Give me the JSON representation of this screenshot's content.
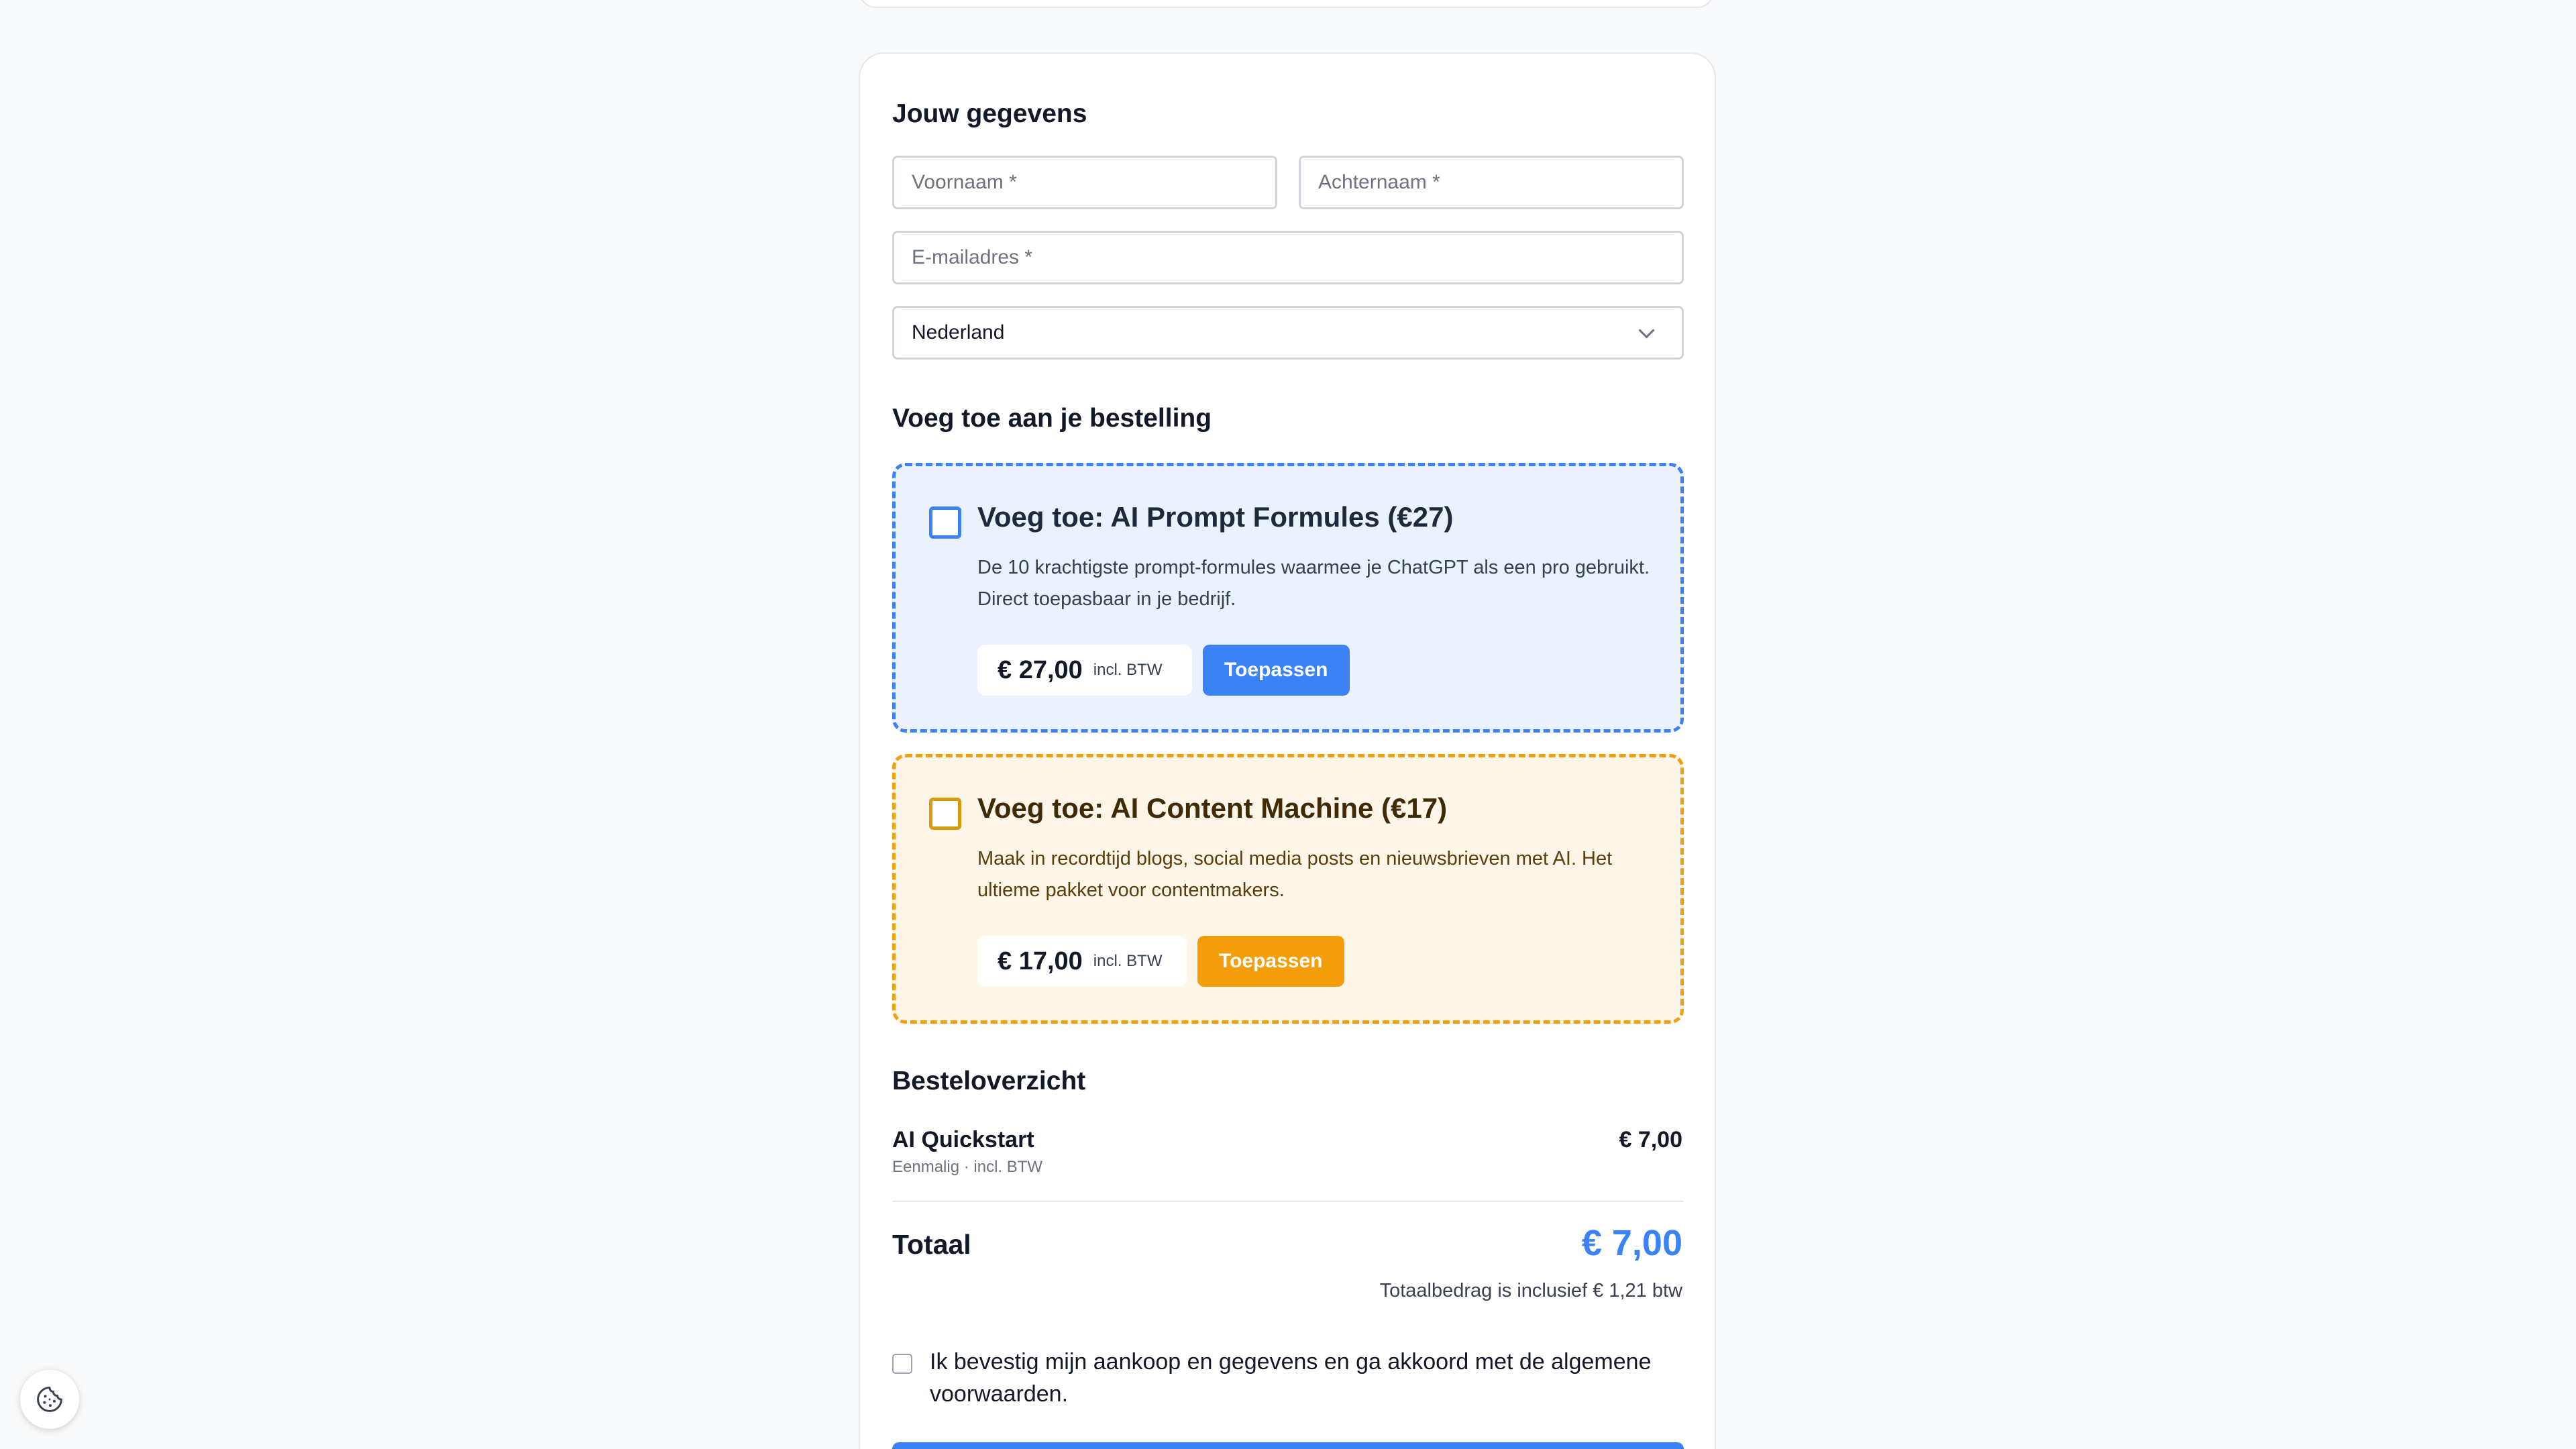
{
  "details": {
    "heading": "Jouw gegevens",
    "first_name_placeholder": "Voornaam *",
    "last_name_placeholder": "Achternaam *",
    "email_placeholder": "E-mailadres *",
    "country_value": "Nederland"
  },
  "order_bumps": {
    "heading": "Voeg toe aan je bestelling",
    "items": [
      {
        "title": "Voeg toe: AI Prompt Formules (€27)",
        "description": "De 10 krachtigste prompt-formules waarmee je ChatGPT als een pro gebruikt. Direct toepasbaar in je bedrijf.",
        "price": "€ 27,00",
        "price_note": "incl. BTW",
        "button_label": "Toepassen",
        "accent_color": "#3b82f6"
      },
      {
        "title": "Voeg toe: AI Content Machine (€17)",
        "description": "Maak in recordtijd blogs, social media posts en nieuwsbrieven met AI. Het ultieme pakket voor contentmakers.",
        "price": "€ 17,00",
        "price_note": "incl. BTW",
        "button_label": "Toepassen",
        "accent_color": "#f59e0b"
      }
    ]
  },
  "summary": {
    "heading": "Besteloverzicht",
    "product_name": "AI Quickstart",
    "product_meta": "Eenmalig · incl. BTW",
    "product_price": "€ 7,00",
    "total_label": "Totaal",
    "total_value": "€ 7,00",
    "total_color": "#3b82f6",
    "vat_note": "Totaalbedrag is inclusief € 1,21 btw"
  },
  "consent": {
    "text": "Ik bevestig mijn aankoop en gegevens en ga akkoord met de algemene voorwaarden."
  },
  "icons": {
    "cookie": "cookie-icon",
    "select_arrow": "chevron-down-icon"
  }
}
